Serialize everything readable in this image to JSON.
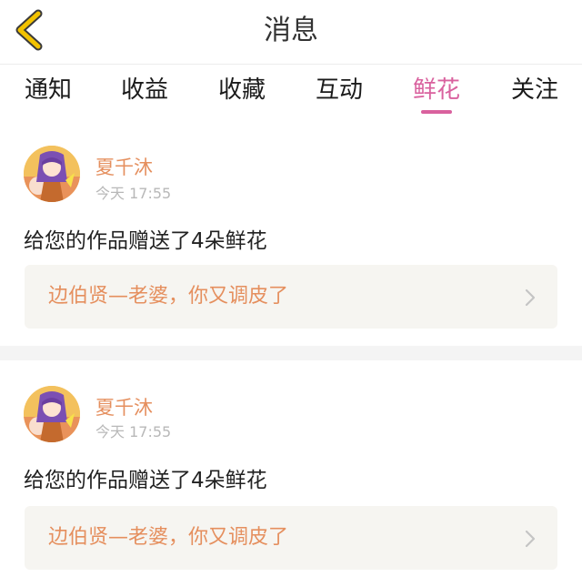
{
  "header": {
    "title": "消息",
    "back_icon": "chevron-left-icon"
  },
  "tabs": [
    {
      "label": "通知",
      "active": false
    },
    {
      "label": "收益",
      "active": false
    },
    {
      "label": "收藏",
      "active": false
    },
    {
      "label": "互动",
      "active": false
    },
    {
      "label": "鲜花",
      "active": true
    },
    {
      "label": "关注",
      "active": false
    }
  ],
  "messages": [
    {
      "username": "夏千沐",
      "time": "今天 17:55",
      "text": "给您的作品赠送了4朵鲜花",
      "work_title": "边伯贤—老婆，你又调皮了",
      "arrow_icon": "chevron-right-icon"
    },
    {
      "username": "夏千沐",
      "time": "今天 17:55",
      "text": "给您的作品赠送了4朵鲜花",
      "work_title": "边伯贤—老婆，你又调皮了",
      "arrow_icon": "chevron-right-icon"
    }
  ],
  "colors": {
    "accent": "#d9619e",
    "username": "#e58f5e",
    "back_icon": "#f2c200",
    "work_box_bg": "#f6f5f1"
  }
}
